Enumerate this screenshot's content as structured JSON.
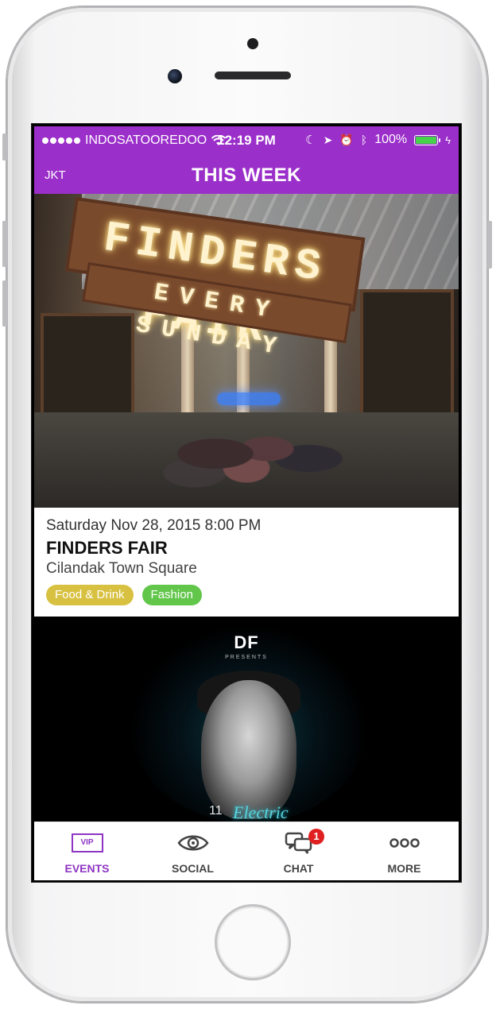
{
  "status_bar": {
    "carrier": "INDOSATOOREDOO",
    "time": "12:19 PM",
    "battery": "100%"
  },
  "nav": {
    "left_label": "JKT",
    "title": "THIS WEEK"
  },
  "events": [
    {
      "image_icon": "finders-fair-photo",
      "sign_text": "FINDERS FAIR",
      "sign_sub": "EVERY SUNDAY",
      "date": "Saturday Nov 28, 2015 8:00 PM",
      "title": "FINDERS FAIR",
      "venue": "Cilandak Town Square",
      "tags": [
        {
          "label": "Food & Drink",
          "color": "#d8c140"
        },
        {
          "label": "Fashion",
          "color": "#62c64a"
        }
      ]
    },
    {
      "image_icon": "dj-poster",
      "poster_logo": "DF",
      "poster_presents": "PRESENTS",
      "poster_number": "11",
      "poster_word": "Electric"
    }
  ],
  "tabs": [
    {
      "label": "EVENTS",
      "icon": "vip-icon",
      "icon_text": "VIP",
      "active": true
    },
    {
      "label": "SOCIAL",
      "icon": "eye-icon",
      "active": false
    },
    {
      "label": "CHAT",
      "icon": "chat-bubbles-icon",
      "badge": "1",
      "active": false
    },
    {
      "label": "MORE",
      "icon": "more-dots-icon",
      "active": false
    }
  ],
  "colors": {
    "accent": "#9b2fc9",
    "tab_active": "#8f35c4",
    "badge": "#e02020"
  }
}
